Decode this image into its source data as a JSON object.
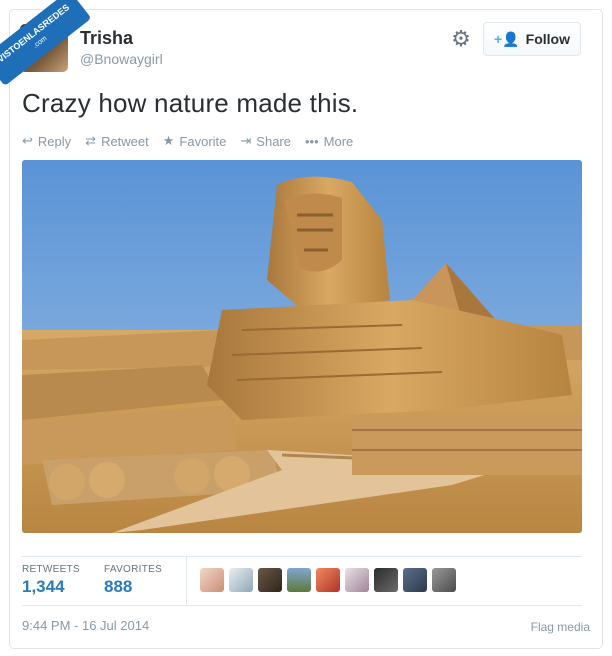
{
  "user": {
    "name": "Trisha",
    "handle": "@Bnowaygirl"
  },
  "watermark": {
    "text": "VISTOENLASREDES",
    "sub": ".com"
  },
  "follow_button": {
    "label": "Follow",
    "icon": "add-user-icon"
  },
  "settings_icon": "gear-icon",
  "tweet": {
    "text": "Crazy how nature made this."
  },
  "actions": [
    {
      "icon": "reply-icon",
      "label": "Reply"
    },
    {
      "icon": "retweet-icon",
      "label": "Retweet"
    },
    {
      "icon": "star-icon",
      "label": "Favorite"
    },
    {
      "icon": "share-icon",
      "label": "Share"
    },
    {
      "icon": "more-icon",
      "label": "More"
    }
  ],
  "stats": {
    "retweets_label": "RETWEETS",
    "retweets": "1,344",
    "favorites_label": "FAVORITES",
    "favorites": "888"
  },
  "timestamp": "9:44 PM - 16 Jul 2014",
  "flag_label": "Flag media",
  "colors": {
    "accent": "#2b7bb9",
    "follow_icon": "#55acee",
    "muted": "#8899a6",
    "text": "#292f33"
  }
}
